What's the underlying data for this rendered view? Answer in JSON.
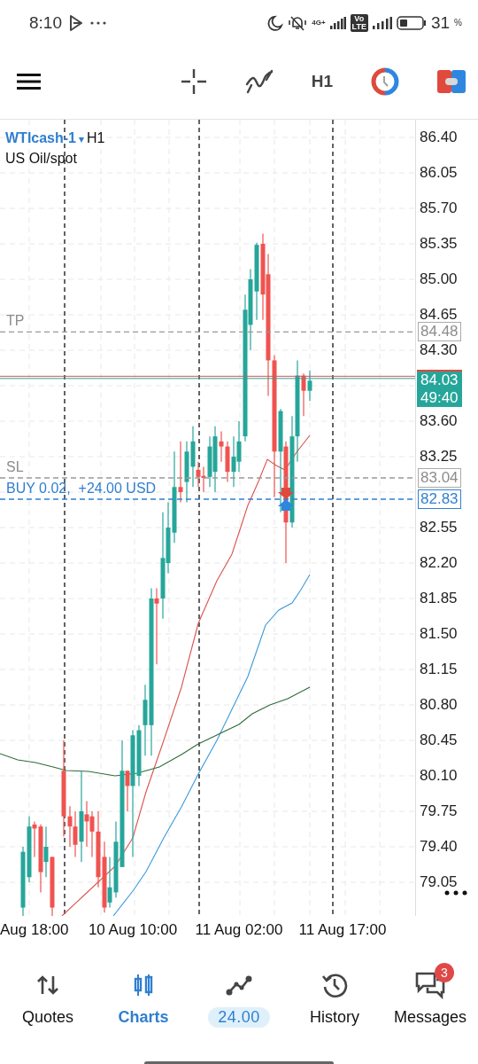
{
  "status_bar": {
    "time": "8:10",
    "network": "4G+",
    "volte": [
      "Vo",
      "LTE"
    ],
    "battery": "31",
    "battery_unit": "%"
  },
  "toolbar": {
    "timeframe": "H1"
  },
  "chart": {
    "symbol": "WTIcash-1",
    "dropdown": "▾",
    "timeframe": "H1",
    "description": "US Oil/spot",
    "price_axis": [
      "86.40",
      "86.05",
      "85.70",
      "85.35",
      "85.00",
      "84.65",
      "84.30",
      "83.60",
      "83.25",
      "82.55",
      "82.20",
      "81.85",
      "81.50",
      "81.15",
      "80.80",
      "80.45",
      "80.10",
      "79.75",
      "79.40",
      "79.05"
    ],
    "time_axis": [
      "Aug 18:00",
      "10 Aug 10:00",
      "11 Aug 02:00",
      "11 Aug 17:00"
    ],
    "levels": [
      {
        "kind": "tp",
        "label": "TP",
        "price": "84.48"
      },
      {
        "kind": "sl",
        "label": "SL",
        "price": "83.04"
      },
      {
        "kind": "order",
        "label": "BUY 0.02,  +24.00 USD",
        "price": "82.83"
      }
    ],
    "current": {
      "price": "84.03",
      "countdown": "49:40"
    }
  },
  "nav": [
    {
      "kind": "quotes",
      "label": "Quotes",
      "selected": false
    },
    {
      "kind": "charts",
      "label": "Charts",
      "selected": true
    },
    {
      "kind": "trade",
      "label": "24.00",
      "selected": false
    },
    {
      "kind": "history",
      "label": "History",
      "selected": false
    },
    {
      "kind": "messages",
      "label": "Messages",
      "selected": false,
      "badge": "3"
    }
  ]
}
